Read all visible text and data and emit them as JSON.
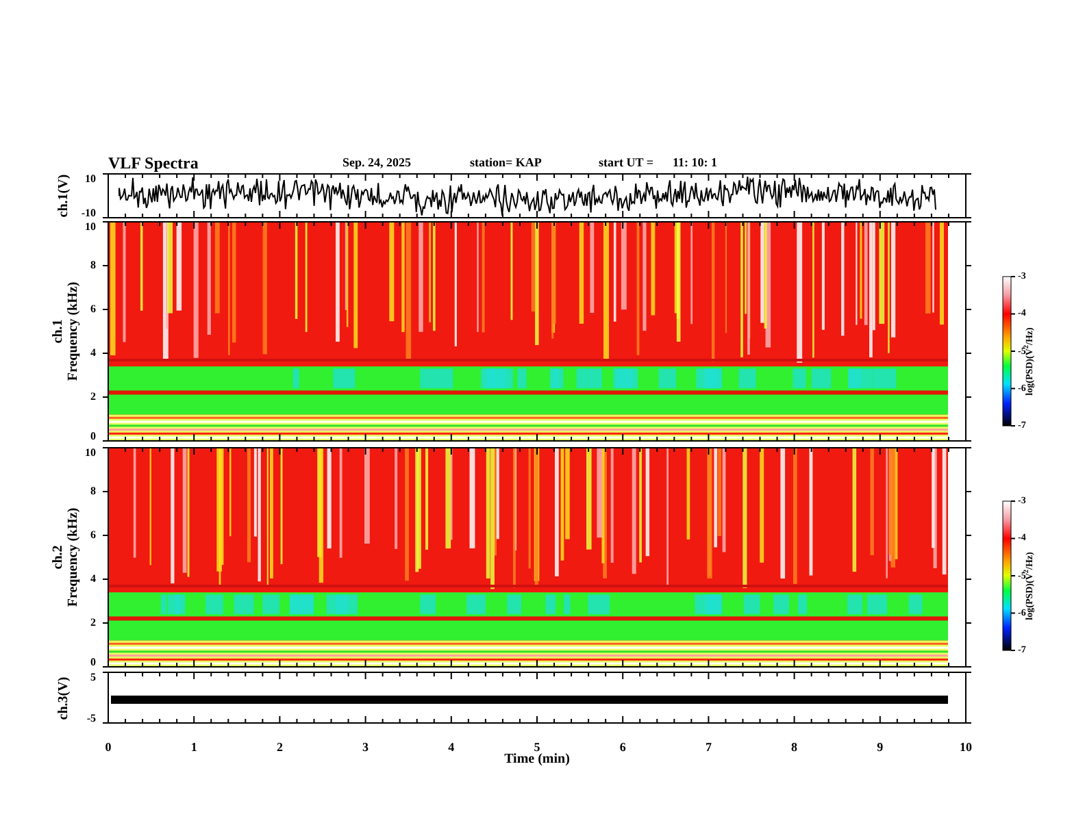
{
  "header": {
    "title": "VLF Spectra",
    "date": "Sep. 24, 2025",
    "station": "station= KAP",
    "start_label": "start UT =",
    "start_time": "11: 10: 1"
  },
  "panels": [
    {
      "kind": "waveform",
      "ylabel": "ch.1(V)",
      "yticks": [
        "10",
        "-10"
      ]
    },
    {
      "kind": "spectrogram",
      "channel": "ch.1",
      "ylabel": "Frequency (kHz)",
      "yticks": [
        "10",
        "8",
        "6",
        "4",
        "2",
        "0"
      ],
      "colorbar": {
        "ticks": [
          "-3",
          "-4",
          "-5",
          "-6",
          "-7"
        ],
        "label": "log(PSD)(V$^{2}$/Hz)"
      }
    },
    {
      "kind": "spectrogram",
      "channel": "ch.2",
      "ylabel": "Frequency (kHz)",
      "yticks": [
        "10",
        "8",
        "6",
        "4",
        "2",
        "0"
      ],
      "colorbar": {
        "ticks": [
          "-3",
          "-4",
          "-5",
          "-6",
          "-7"
        ],
        "label": "log(PSD)(V$^{2}$/Hz)"
      }
    },
    {
      "kind": "band",
      "ylabel": "ch.3(V)",
      "yticks": [
        "5",
        "-5"
      ]
    }
  ],
  "x_axis": {
    "ticks": [
      "0",
      "1",
      "2",
      "3",
      "4",
      "5",
      "6",
      "7",
      "8",
      "9",
      "10"
    ],
    "label": "Time (min)"
  }
}
